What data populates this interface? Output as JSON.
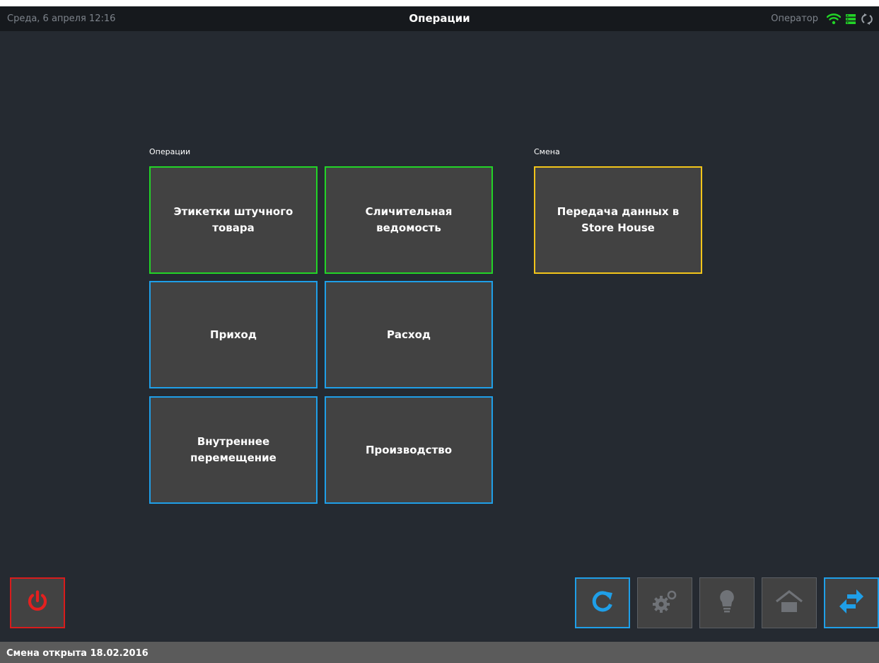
{
  "header": {
    "datetime": "Среда, 6 апреля 12:16",
    "title": "Операции",
    "operator": "Оператор"
  },
  "sections": {
    "operations_label": "Операции",
    "shift_label": "Смена"
  },
  "tiles": {
    "labels": "Этикетки штучного товара",
    "reconciliation": "Сличительная ведомость",
    "income": "Приход",
    "expense": "Расход",
    "internal_transfer": "Внутреннее перемещение",
    "production": "Производство",
    "store_house_transfer": "Передача данных в Store House"
  },
  "toolbar": {
    "icons": [
      "power-icon",
      "refresh-icon",
      "gears-icon",
      "bulb-icon",
      "home-icon",
      "sync-arrows-icon"
    ]
  },
  "status": {
    "shift_opened": "Смена открыта 18.02.2016"
  },
  "colors": {
    "background": "#252a31",
    "tile": "#424242",
    "green_border": "#22d427",
    "blue_border": "#1f9fe8",
    "yellow_border": "#f2c51a",
    "red_border": "#d81c1c",
    "accent_blue": "#1f9fe8"
  }
}
